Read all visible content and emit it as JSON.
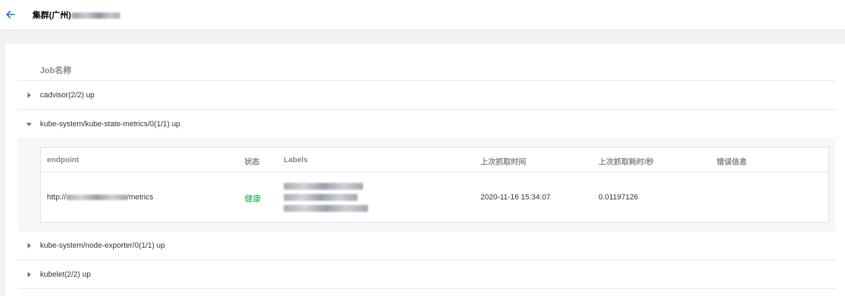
{
  "header": {
    "title": "集群(广州)",
    "title_redacted": "cls-xxxxxxxx"
  },
  "table": {
    "column_job": "Job名称"
  },
  "jobs": [
    {
      "label": "cadvisor(2/2) up",
      "expanded": false
    },
    {
      "label": "kube-system/kube-state-metrics/0(1/1) up",
      "expanded": true
    },
    {
      "label": "kube-system/node-exporter/0(1/1) up",
      "expanded": false
    },
    {
      "label": "kubelet(2/2) up",
      "expanded": false
    }
  ],
  "detail": {
    "columns": {
      "endpoint": "endpoint",
      "status": "状态",
      "labels": "Labels",
      "last_scrape": "上次抓取时间",
      "scrape_duration": "上次抓取耗时/秒",
      "error": "错误信息"
    },
    "row": {
      "endpoint_prefix": "http://",
      "endpoint_suffix": "/metrics",
      "status": "健康",
      "last_scrape": "2020-11-16 15:34:07",
      "scrape_duration": "0.01197126",
      "error": ""
    }
  },
  "colors": {
    "accent": "#006eff",
    "healthy": "#1aab45",
    "border": "#e5e5e5"
  }
}
